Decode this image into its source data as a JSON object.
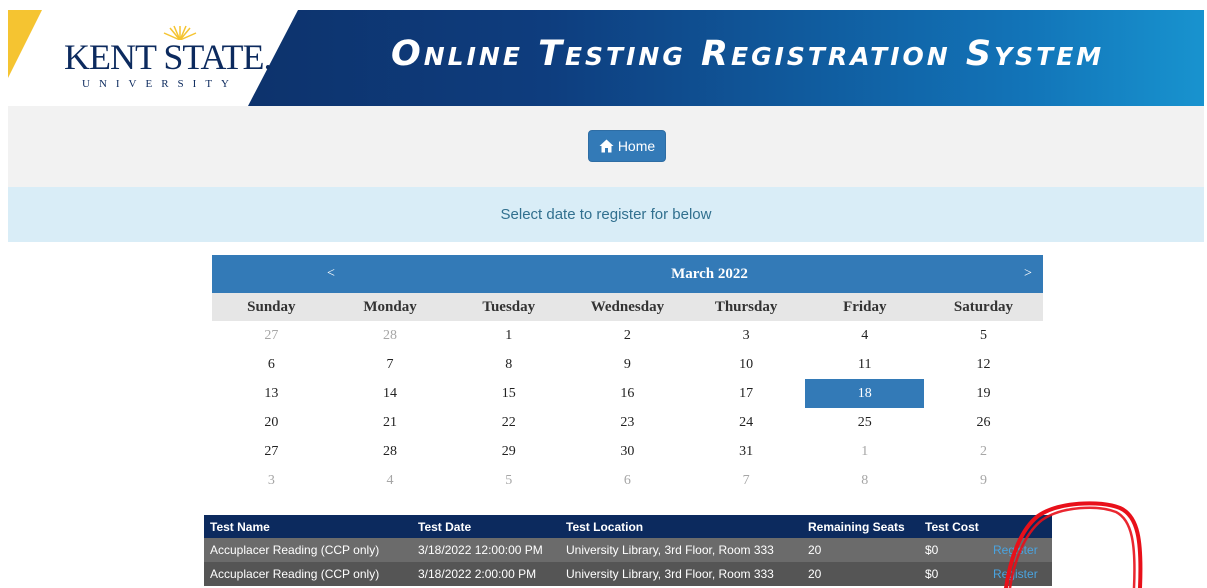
{
  "banner": {
    "logo_main": "KENT STATE.",
    "logo_sub": "UNIVERSITY",
    "title": "Online Testing Registration System",
    "colors": {
      "navy": "#0c2a5e",
      "gold": "#f5c431",
      "light_blue": "#1893cf"
    }
  },
  "nav": {
    "home_label": "Home",
    "home_icon": "home-icon"
  },
  "info": {
    "message": "Select date to register for below"
  },
  "calendar": {
    "prev": "<",
    "month": "March 2022",
    "next": ">",
    "weekdays": [
      "Sunday",
      "Monday",
      "Tuesday",
      "Wednesday",
      "Thursday",
      "Friday",
      "Saturday"
    ],
    "selected_date": "18",
    "weeks": [
      [
        "27",
        "28",
        "1",
        "2",
        "3",
        "4",
        "5"
      ],
      [
        "6",
        "7",
        "8",
        "9",
        "10",
        "11",
        "12"
      ],
      [
        "13",
        "14",
        "15",
        "16",
        "17",
        "18",
        "19"
      ],
      [
        "20",
        "21",
        "22",
        "23",
        "24",
        "25",
        "26"
      ],
      [
        "27",
        "28",
        "29",
        "30",
        "31",
        "1",
        "2"
      ],
      [
        "3",
        "4",
        "5",
        "6",
        "7",
        "8",
        "9"
      ]
    ]
  },
  "tests": {
    "headers": [
      "Test Name",
      "Test Date",
      "Test Location",
      "Remaining Seats",
      "Test Cost",
      ""
    ],
    "rows": [
      {
        "name": "Accuplacer Reading (CCP only)",
        "date": "3/18/2022 12:00:00 PM",
        "location": "University Library, 3rd Floor, Room 333",
        "seats": "20",
        "cost": "$0",
        "action": "Register"
      },
      {
        "name": "Accuplacer Reading (CCP only)",
        "date": "3/18/2022 2:00:00 PM",
        "location": "University Library, 3rd Floor, Room 333",
        "seats": "20",
        "cost": "$0",
        "action": "Register"
      }
    ]
  }
}
